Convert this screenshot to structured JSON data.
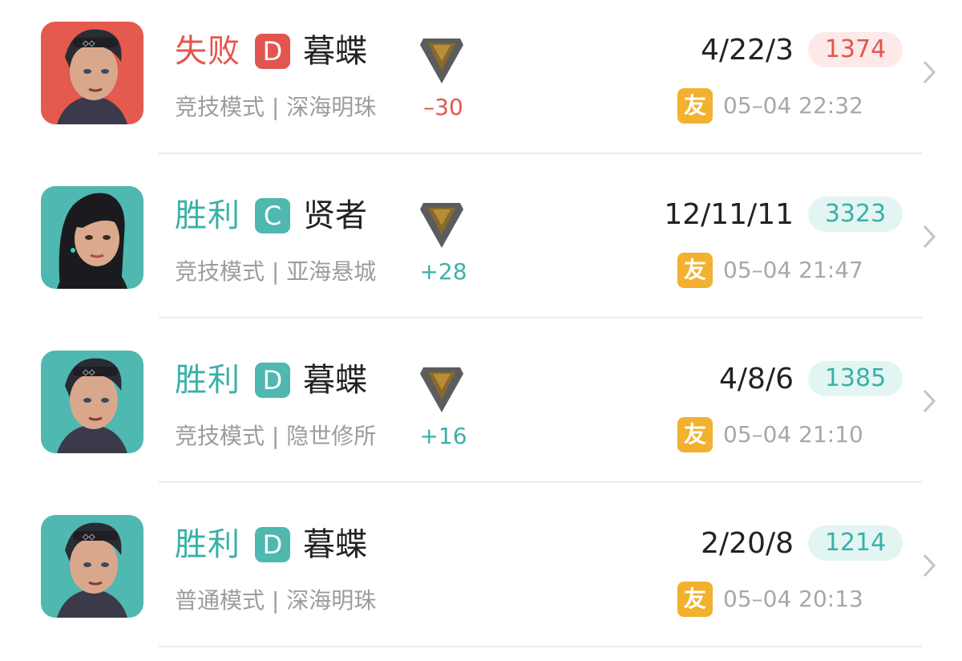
{
  "matches": [
    {
      "result": "失败",
      "outcome": "loss",
      "grade": "D",
      "hero": "暮蝶",
      "mode": "竞技模式 | 深海明珠",
      "has_rank_icon": true,
      "rank_delta": "–30",
      "kda": "4/22/3",
      "score": "1374",
      "friend_badge": "友",
      "time": "05–04 22:32",
      "avatar_bg": "#e45a4f"
    },
    {
      "result": "胜利",
      "outcome": "win",
      "grade": "C",
      "hero": "贤者",
      "mode": "竞技模式 | 亚海悬城",
      "has_rank_icon": true,
      "rank_delta": "+28",
      "kda": "12/11/11",
      "score": "3323",
      "friend_badge": "友",
      "time": "05–04 21:47",
      "avatar_bg": "#4fb8b0"
    },
    {
      "result": "胜利",
      "outcome": "win",
      "grade": "D",
      "hero": "暮蝶",
      "mode": "竞技模式 | 隐世修所",
      "has_rank_icon": true,
      "rank_delta": "+16",
      "kda": "4/8/6",
      "score": "1385",
      "friend_badge": "友",
      "time": "05–04 21:10",
      "avatar_bg": "#4fb8b0"
    },
    {
      "result": "胜利",
      "outcome": "win",
      "grade": "D",
      "hero": "暮蝶",
      "mode": "普通模式 | 深海明珠",
      "has_rank_icon": false,
      "rank_delta": "",
      "kda": "2/20/8",
      "score": "1214",
      "friend_badge": "友",
      "time": "05–04 20:13",
      "avatar_bg": "#4fb8b0"
    }
  ],
  "colors": {
    "loss": "#e3564f",
    "win": "#39b1a8",
    "friend_badge": "#f2b12e"
  },
  "icons": {
    "rank": "rank-diamond-icon",
    "chevron": "chevron-right-icon",
    "avatar": "hero-avatar"
  }
}
